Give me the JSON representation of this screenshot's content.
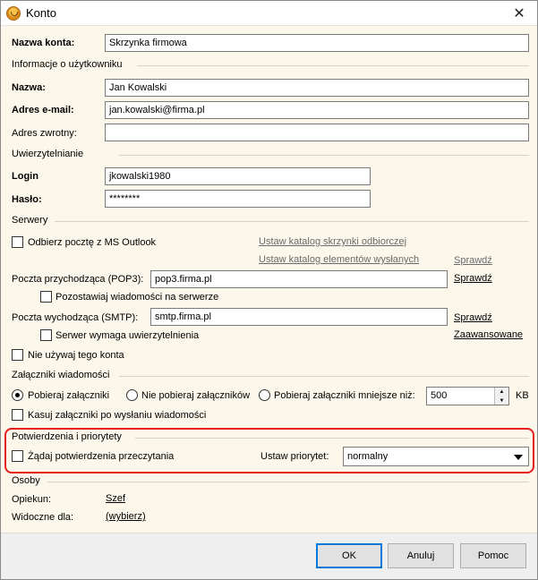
{
  "window": {
    "title": "Konto",
    "close_glyph": "✕"
  },
  "account": {
    "name_label": "Nazwa konta:",
    "name_value": "Skrzynka firmowa"
  },
  "user_info": {
    "section": "Informacje o użytkowniku",
    "name_label": "Nazwa:",
    "name_value": "Jan Kowalski",
    "email_label": "Adres e-mail:",
    "email_value": "jan.kowalski@firma.pl",
    "reply_label": "Adres zwrotny:",
    "reply_value": ""
  },
  "auth": {
    "section": "Uwierzytelnianie",
    "login_label": "Login",
    "login_value": "jkowalski1980",
    "password_label": "Hasło:",
    "password_value": "********"
  },
  "servers": {
    "section": "Serwery",
    "outlook_label": "Odbierz pocztę z MS Outlook",
    "inbox_catalog_link": "Ustaw katalog skrzynki odbiorczej",
    "sent_catalog_link": "Ustaw katalog elementów wysłanych",
    "check_link_disabled": "Sprawdź",
    "pop3_label": "Poczta przychodząca (POP3):",
    "pop3_value": "pop3.firma.pl",
    "pop3_check_link": "Sprawdź",
    "leave_on_server_label": "Pozostawiaj wiadomości na serwerze",
    "smtp_label": "Poczta wychodząca (SMTP):",
    "smtp_value": "smtp.firma.pl",
    "smtp_check_link": "Sprawdź",
    "smtp_auth_label": "Serwer wymaga uwierzytelnienia",
    "advanced_link": "Zaawansowane",
    "disable_account_label": "Nie używaj tego konta"
  },
  "attachments": {
    "section": "Załączniki wiadomości",
    "opt_download": "Pobieraj załączniki",
    "opt_no_download": "Nie pobieraj załączników",
    "opt_smaller": "Pobieraj załączniki mniejsze niż:",
    "size_value": "500",
    "size_unit": "KB",
    "delete_after_send_label": "Kasuj załączniki po wysłaniu wiadomości"
  },
  "receipts": {
    "section": "Potwierdzenia i priorytety",
    "read_receipt_label": "Żądaj potwierdzenia przeczytania",
    "priority_label": "Ustaw priorytet:",
    "priority_value": "normalny"
  },
  "people": {
    "section": "Osoby",
    "guardian_label": "Opiekun:",
    "guardian_link": "Szef",
    "visible_label": "Widoczne dla:",
    "visible_link": "(wybierz)"
  },
  "buttons": {
    "ok": "OK",
    "cancel": "Anuluj",
    "help": "Pomoc"
  }
}
